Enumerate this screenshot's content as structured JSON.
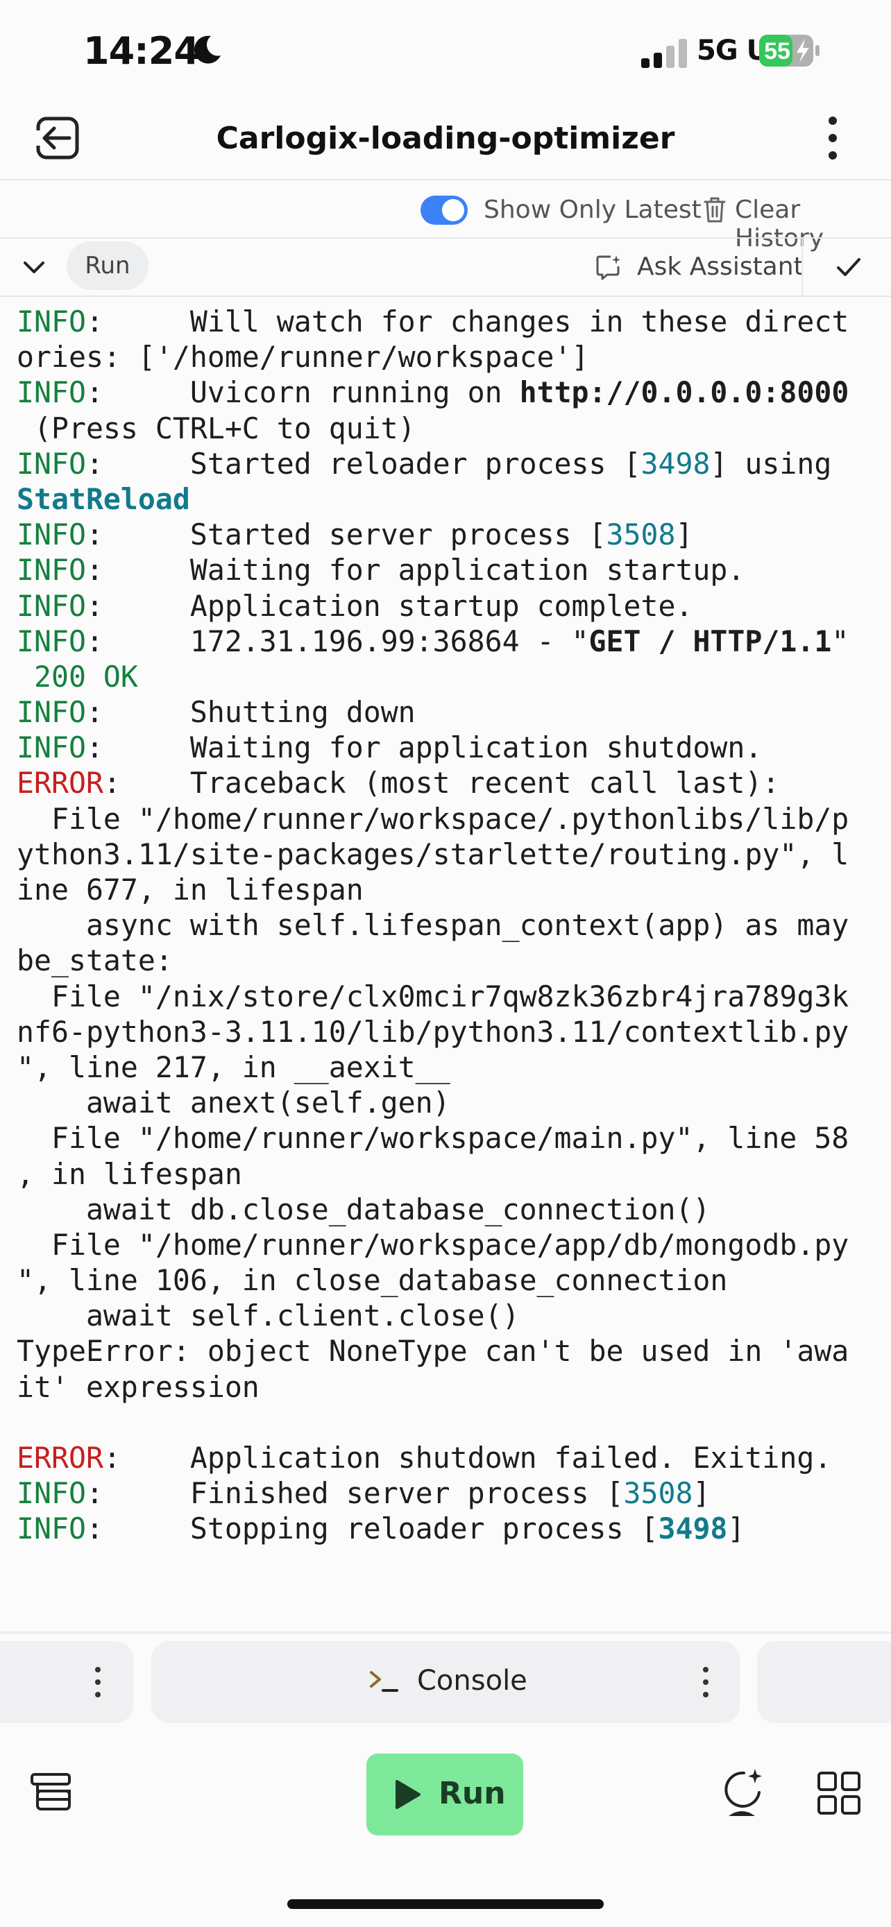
{
  "status_bar": {
    "time": "14:24",
    "network": "5G UC",
    "battery": "55",
    "icons": [
      "moon-icon",
      "signal-icon",
      "battery-charging-icon"
    ]
  },
  "header": {
    "title": "Carlogix-loading-optimizer",
    "icons": [
      "exit-icon",
      "more-vertical-icon"
    ]
  },
  "filters": {
    "show_only_latest_label": "Show Only Latest",
    "show_only_latest_on": true,
    "clear_history_label": "Clear History"
  },
  "console_toolbar": {
    "run_chip": "Run",
    "ask_assistant_label": "Ask Assistant"
  },
  "colors": {
    "info": "#15803d",
    "error": "#c81e1e",
    "number": "#117a8b",
    "toggle": "#3b82f6",
    "run_button": "#7ee89a"
  },
  "log_lines": [
    [
      {
        "t": "INFO",
        "c": "info"
      },
      {
        "t": ":     Will watch for changes in these direct"
      }
    ],
    [
      {
        "t": "ories: ['/home/runner/workspace']"
      }
    ],
    [
      {
        "t": "INFO",
        "c": "info"
      },
      {
        "t": ":     Uvicorn running on "
      },
      {
        "t": "http://0.0.0.0:8000",
        "c": "bold"
      }
    ],
    [
      {
        "t": " (Press CTRL+C to quit)"
      }
    ],
    [
      {
        "t": "INFO",
        "c": "info"
      },
      {
        "t": ":     Started reloader process ["
      },
      {
        "t": "3498",
        "c": "num"
      },
      {
        "t": "] using"
      }
    ],
    [
      {
        "t": "StatReload",
        "c": "numbold"
      }
    ],
    [
      {
        "t": "INFO",
        "c": "info"
      },
      {
        "t": ":     Started server process ["
      },
      {
        "t": "3508",
        "c": "num"
      },
      {
        "t": "]"
      }
    ],
    [
      {
        "t": "INFO",
        "c": "info"
      },
      {
        "t": ":     Waiting for application startup."
      }
    ],
    [
      {
        "t": "INFO",
        "c": "info"
      },
      {
        "t": ":     Application startup complete."
      }
    ],
    [
      {
        "t": "INFO",
        "c": "info"
      },
      {
        "t": ":     172.31.196.99:36864 - \""
      },
      {
        "t": "GET / HTTP/1.1",
        "c": "bold"
      },
      {
        "t": "\""
      }
    ],
    [
      {
        "t": " 200 OK",
        "c": "ok"
      }
    ],
    [
      {
        "t": "INFO",
        "c": "info"
      },
      {
        "t": ":     Shutting down"
      }
    ],
    [
      {
        "t": "INFO",
        "c": "info"
      },
      {
        "t": ":     Waiting for application shutdown."
      }
    ],
    [
      {
        "t": "ERROR",
        "c": "error"
      },
      {
        "t": ":    Traceback (most recent call last):"
      }
    ],
    [
      {
        "t": "  File \"/home/runner/workspace/.pythonlibs/lib/p"
      }
    ],
    [
      {
        "t": "ython3.11/site-packages/starlette/routing.py\", l"
      }
    ],
    [
      {
        "t": "ine 677, in lifespan"
      }
    ],
    [
      {
        "t": "    async with self.lifespan_context(app) as may"
      }
    ],
    [
      {
        "t": "be_state:"
      }
    ],
    [
      {
        "t": "  File \"/nix/store/clx0mcir7qw8zk36zbr4jra789g3k"
      }
    ],
    [
      {
        "t": "nf6-python3-3.11.10/lib/python3.11/contextlib.py"
      }
    ],
    [
      {
        "t": "\", line 217, in __aexit__"
      }
    ],
    [
      {
        "t": "    await anext(self.gen)"
      }
    ],
    [
      {
        "t": "  File \"/home/runner/workspace/main.py\", line 58"
      }
    ],
    [
      {
        "t": ", in lifespan"
      }
    ],
    [
      {
        "t": "    await db.close_database_connection()"
      }
    ],
    [
      {
        "t": "  File \"/home/runner/workspace/app/db/mongodb.py"
      }
    ],
    [
      {
        "t": "\", line 106, in close_database_connection"
      }
    ],
    [
      {
        "t": "    await self.client.close()"
      }
    ],
    [
      {
        "t": "TypeError: object NoneType can't be used in 'awa"
      }
    ],
    [
      {
        "t": "it' expression"
      }
    ],
    [
      {
        "t": ""
      }
    ],
    [
      {
        "t": "ERROR",
        "c": "error"
      },
      {
        "t": ":    Application shutdown failed. Exiting."
      }
    ],
    [
      {
        "t": "INFO",
        "c": "info"
      },
      {
        "t": ":     Finished server process ["
      },
      {
        "t": "3508",
        "c": "num"
      },
      {
        "t": "]"
      }
    ],
    [
      {
        "t": "INFO",
        "c": "info"
      },
      {
        "t": ":     Stopping reloader process ["
      },
      {
        "t": "3498",
        "c": "numbold"
      },
      {
        "t": "]"
      }
    ]
  ],
  "tabs": {
    "console_label": "Console",
    "icons": [
      "console-prompt-icon",
      "more-vertical-icon"
    ]
  },
  "bottom_nav": {
    "run_label": "Run",
    "icons": [
      "layers-icon",
      "play-icon",
      "ai-assistant-icon",
      "grid-icon"
    ]
  }
}
